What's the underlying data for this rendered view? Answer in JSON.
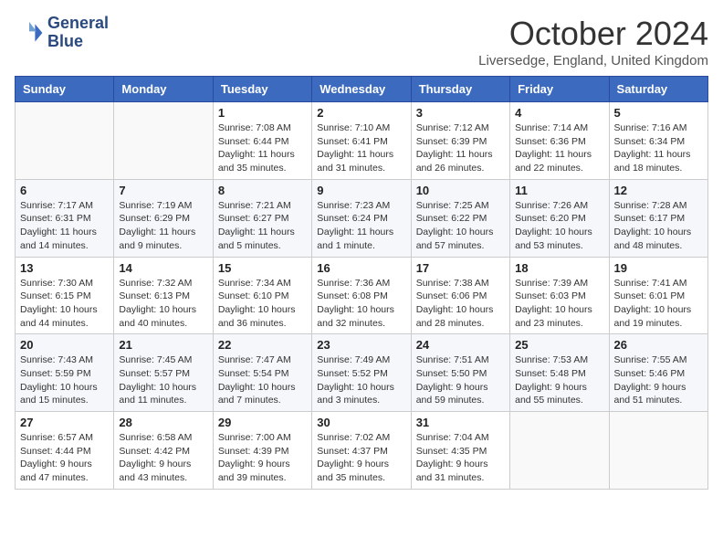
{
  "logo": {
    "line1": "General",
    "line2": "Blue"
  },
  "title": "October 2024",
  "location": "Liversedge, England, United Kingdom",
  "days_of_week": [
    "Sunday",
    "Monday",
    "Tuesday",
    "Wednesday",
    "Thursday",
    "Friday",
    "Saturday"
  ],
  "weeks": [
    [
      {
        "day": "",
        "info": ""
      },
      {
        "day": "",
        "info": ""
      },
      {
        "day": "1",
        "info": "Sunrise: 7:08 AM\nSunset: 6:44 PM\nDaylight: 11 hours and 35 minutes."
      },
      {
        "day": "2",
        "info": "Sunrise: 7:10 AM\nSunset: 6:41 PM\nDaylight: 11 hours and 31 minutes."
      },
      {
        "day": "3",
        "info": "Sunrise: 7:12 AM\nSunset: 6:39 PM\nDaylight: 11 hours and 26 minutes."
      },
      {
        "day": "4",
        "info": "Sunrise: 7:14 AM\nSunset: 6:36 PM\nDaylight: 11 hours and 22 minutes."
      },
      {
        "day": "5",
        "info": "Sunrise: 7:16 AM\nSunset: 6:34 PM\nDaylight: 11 hours and 18 minutes."
      }
    ],
    [
      {
        "day": "6",
        "info": "Sunrise: 7:17 AM\nSunset: 6:31 PM\nDaylight: 11 hours and 14 minutes."
      },
      {
        "day": "7",
        "info": "Sunrise: 7:19 AM\nSunset: 6:29 PM\nDaylight: 11 hours and 9 minutes."
      },
      {
        "day": "8",
        "info": "Sunrise: 7:21 AM\nSunset: 6:27 PM\nDaylight: 11 hours and 5 minutes."
      },
      {
        "day": "9",
        "info": "Sunrise: 7:23 AM\nSunset: 6:24 PM\nDaylight: 11 hours and 1 minute."
      },
      {
        "day": "10",
        "info": "Sunrise: 7:25 AM\nSunset: 6:22 PM\nDaylight: 10 hours and 57 minutes."
      },
      {
        "day": "11",
        "info": "Sunrise: 7:26 AM\nSunset: 6:20 PM\nDaylight: 10 hours and 53 minutes."
      },
      {
        "day": "12",
        "info": "Sunrise: 7:28 AM\nSunset: 6:17 PM\nDaylight: 10 hours and 48 minutes."
      }
    ],
    [
      {
        "day": "13",
        "info": "Sunrise: 7:30 AM\nSunset: 6:15 PM\nDaylight: 10 hours and 44 minutes."
      },
      {
        "day": "14",
        "info": "Sunrise: 7:32 AM\nSunset: 6:13 PM\nDaylight: 10 hours and 40 minutes."
      },
      {
        "day": "15",
        "info": "Sunrise: 7:34 AM\nSunset: 6:10 PM\nDaylight: 10 hours and 36 minutes."
      },
      {
        "day": "16",
        "info": "Sunrise: 7:36 AM\nSunset: 6:08 PM\nDaylight: 10 hours and 32 minutes."
      },
      {
        "day": "17",
        "info": "Sunrise: 7:38 AM\nSunset: 6:06 PM\nDaylight: 10 hours and 28 minutes."
      },
      {
        "day": "18",
        "info": "Sunrise: 7:39 AM\nSunset: 6:03 PM\nDaylight: 10 hours and 23 minutes."
      },
      {
        "day": "19",
        "info": "Sunrise: 7:41 AM\nSunset: 6:01 PM\nDaylight: 10 hours and 19 minutes."
      }
    ],
    [
      {
        "day": "20",
        "info": "Sunrise: 7:43 AM\nSunset: 5:59 PM\nDaylight: 10 hours and 15 minutes."
      },
      {
        "day": "21",
        "info": "Sunrise: 7:45 AM\nSunset: 5:57 PM\nDaylight: 10 hours and 11 minutes."
      },
      {
        "day": "22",
        "info": "Sunrise: 7:47 AM\nSunset: 5:54 PM\nDaylight: 10 hours and 7 minutes."
      },
      {
        "day": "23",
        "info": "Sunrise: 7:49 AM\nSunset: 5:52 PM\nDaylight: 10 hours and 3 minutes."
      },
      {
        "day": "24",
        "info": "Sunrise: 7:51 AM\nSunset: 5:50 PM\nDaylight: 9 hours and 59 minutes."
      },
      {
        "day": "25",
        "info": "Sunrise: 7:53 AM\nSunset: 5:48 PM\nDaylight: 9 hours and 55 minutes."
      },
      {
        "day": "26",
        "info": "Sunrise: 7:55 AM\nSunset: 5:46 PM\nDaylight: 9 hours and 51 minutes."
      }
    ],
    [
      {
        "day": "27",
        "info": "Sunrise: 6:57 AM\nSunset: 4:44 PM\nDaylight: 9 hours and 47 minutes."
      },
      {
        "day": "28",
        "info": "Sunrise: 6:58 AM\nSunset: 4:42 PM\nDaylight: 9 hours and 43 minutes."
      },
      {
        "day": "29",
        "info": "Sunrise: 7:00 AM\nSunset: 4:39 PM\nDaylight: 9 hours and 39 minutes."
      },
      {
        "day": "30",
        "info": "Sunrise: 7:02 AM\nSunset: 4:37 PM\nDaylight: 9 hours and 35 minutes."
      },
      {
        "day": "31",
        "info": "Sunrise: 7:04 AM\nSunset: 4:35 PM\nDaylight: 9 hours and 31 minutes."
      },
      {
        "day": "",
        "info": ""
      },
      {
        "day": "",
        "info": ""
      }
    ]
  ]
}
